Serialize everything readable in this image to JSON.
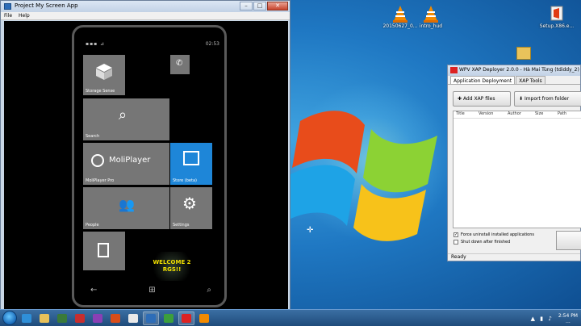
{
  "pms": {
    "title": "Project My Screen App",
    "menu": [
      "File",
      "Help"
    ],
    "close_glyph": "✕",
    "min_glyph": "–",
    "max_glyph": "□"
  },
  "phone": {
    "time": "02:53",
    "signal": "▪▪▪ ⊿",
    "tiles": {
      "storage_sense": "Storage Sense",
      "search": "Search",
      "moliplayer_logo": "MoliPlayer",
      "moliplayer": "MoliPlayer Pro",
      "store": "Store (beta)",
      "people": "People",
      "settings": "Settings"
    },
    "welcome": [
      "WELCOME 2",
      "RGS!!"
    ],
    "nav": {
      "back": "←",
      "start": "⊞",
      "search": "⌕"
    }
  },
  "desktop": {
    "icons": [
      {
        "label": "20150627_0..."
      },
      {
        "label": "intro_hud"
      },
      {
        "label": "Setup.X86.e..."
      }
    ]
  },
  "xap": {
    "title": "WPV XAP Deployer 2.0.0 - Hà Mai Tùng (tdiddy_2)",
    "tabs": [
      "Application Deployment",
      "XAP Tools"
    ],
    "buttons": {
      "add": "Add XAP files",
      "import": "Import from folder"
    },
    "columns": [
      "Title",
      "Version",
      "Author",
      "Size",
      "Path"
    ],
    "options": {
      "force_uninstall": "Force uninstall installed applications",
      "shutdown": "Shut down after finished"
    },
    "status": "Ready"
  },
  "taskbar": {
    "clock_time": "2:54 PM",
    "clock_date": "..."
  }
}
